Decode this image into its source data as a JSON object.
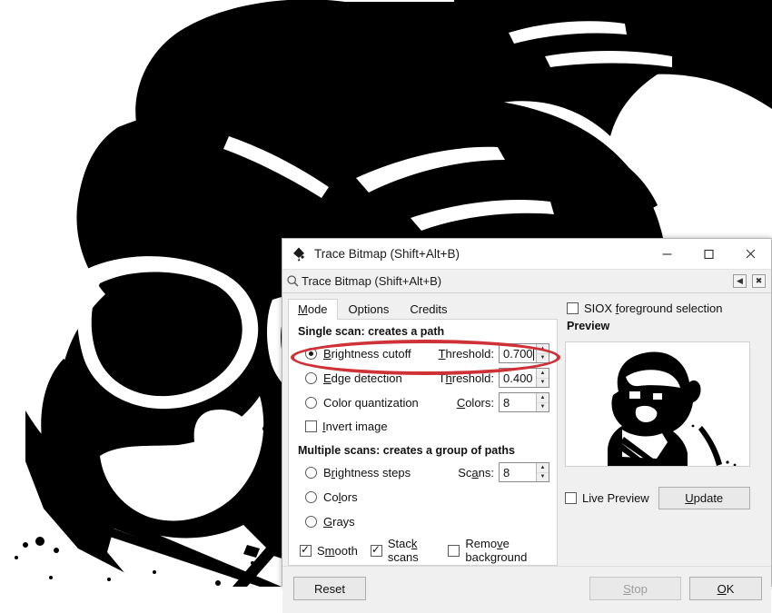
{
  "window": {
    "title": "Trace Bitmap (Shift+Alt+B)",
    "app_icon": "inkscape-logo-icon",
    "minimize_label": "—",
    "maximize_label": "☐",
    "close_label": "✕"
  },
  "panel_header": {
    "title": "Trace Bitmap (Shift+Alt+B)",
    "icon": "trace-bitmap-icon",
    "dock_label": "◀",
    "close_label": "✖"
  },
  "tabs": [
    {
      "label": "Mode",
      "active": true
    },
    {
      "label": "Options",
      "active": false
    },
    {
      "label": "Credits",
      "active": false
    }
  ],
  "single_scan": {
    "title": "Single scan: creates a path",
    "options": [
      {
        "label": "Brightness cutoff",
        "selected": true,
        "field_label": "Threshold:",
        "value": "0.700",
        "focused": true
      },
      {
        "label": "Edge detection",
        "selected": false,
        "field_label": "Threshold:",
        "value": "0.400",
        "focused": false
      },
      {
        "label": "Color quantization",
        "selected": false,
        "field_label": "Colors:",
        "value": "8",
        "focused": false
      }
    ],
    "invert_image": {
      "label": "Invert image",
      "checked": false
    }
  },
  "multiple_scans": {
    "title": "Multiple scans: creates a group of paths",
    "options": [
      {
        "label": "Brightness steps",
        "selected": false,
        "field_label": "Scans:",
        "value": "8"
      },
      {
        "label": "Colors",
        "selected": false
      },
      {
        "label": "Grays",
        "selected": false
      }
    ],
    "toggles": [
      {
        "label": "Smooth",
        "checked": true
      },
      {
        "label": "Stack scans",
        "checked": true
      },
      {
        "label": "Remove background",
        "checked": false
      }
    ]
  },
  "right_panel": {
    "siox": {
      "label": "SIOX foreground selection",
      "checked": false
    },
    "preview_label": "Preview",
    "live_preview": {
      "label": "Live Preview",
      "checked": false
    },
    "update_label": "Update"
  },
  "footer": {
    "reset_label": "Reset",
    "stop_label": "Stop",
    "stop_disabled": true,
    "ok_label": "OK"
  },
  "annotation": {
    "type": "red-oval-highlight",
    "target": "Brightness cutoff threshold row",
    "color": "#cf3236"
  },
  "colors": {
    "dialog_background": "#f0f0f0",
    "panel_white": "#ffffff",
    "text": "#111111",
    "accent_red": "#cf3236",
    "button_face": "#e9e9e9",
    "disabled_text": "#9d9d9d"
  }
}
